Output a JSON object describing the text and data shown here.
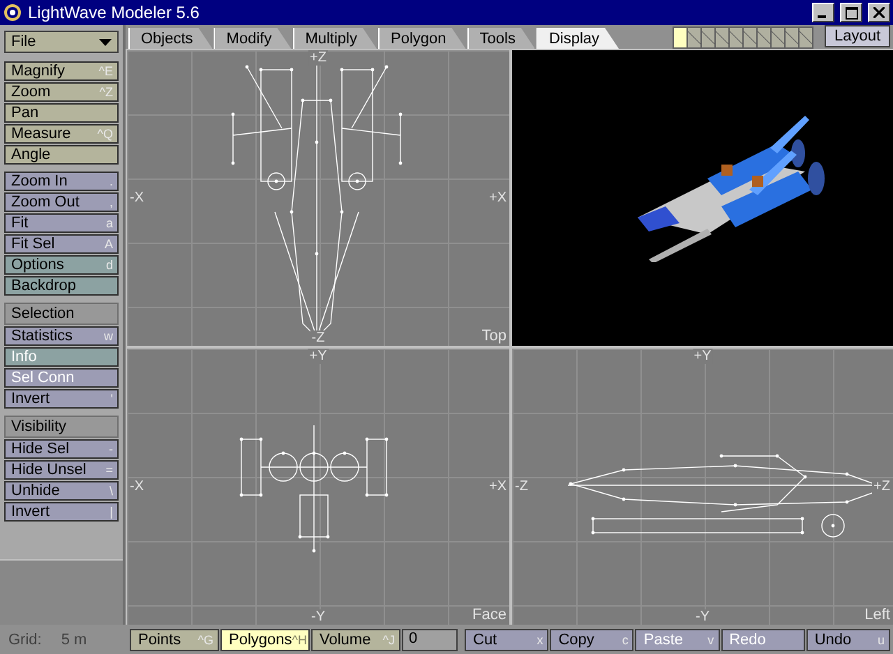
{
  "window": {
    "title": "LightWave Modeler 5.6"
  },
  "tabs": [
    {
      "label": "Objects",
      "selected": false
    },
    {
      "label": "Modify",
      "selected": false
    },
    {
      "label": "Multiply",
      "selected": false
    },
    {
      "label": "Polygon",
      "selected": false
    },
    {
      "label": "Tools",
      "selected": false
    },
    {
      "label": "Display",
      "selected": true
    }
  ],
  "layers": [
    {
      "selected": true
    },
    {
      "selected": false
    },
    {
      "selected": false
    },
    {
      "selected": false
    },
    {
      "selected": false
    },
    {
      "selected": false
    },
    {
      "selected": false
    },
    {
      "selected": false
    },
    {
      "selected": false
    },
    {
      "selected": false
    }
  ],
  "layout_button": "Layout",
  "sidebar": {
    "menu": "File",
    "groups": [
      {
        "kind": "tool",
        "items": [
          {
            "label": "Magnify",
            "shortcut": "^E",
            "disabled": false
          },
          {
            "label": "Zoom",
            "shortcut": "^Z",
            "disabled": false
          },
          {
            "label": "Pan",
            "disabled": false
          },
          {
            "label": "Measure",
            "shortcut": "^Q",
            "disabled": false
          },
          {
            "label": "Angle",
            "disabled": false
          }
        ]
      },
      {
        "kind": "view",
        "items": [
          {
            "label": "Zoom In",
            "shortcut": ".",
            "disabled": false
          },
          {
            "label": "Zoom Out",
            "shortcut": ",",
            "disabled": false
          },
          {
            "label": "Fit",
            "shortcut": "a",
            "disabled": false
          },
          {
            "label": "Fit Sel",
            "shortcut": "A",
            "disabled": false
          },
          {
            "label": "Options",
            "shortcut": "d",
            "kind": "option",
            "disabled": false
          },
          {
            "label": "Backdrop",
            "kind": "option",
            "disabled": false
          }
        ]
      },
      {
        "kind": "view",
        "header": "Selection",
        "items": [
          {
            "label": "Statistics",
            "shortcut": "w",
            "disabled": false
          },
          {
            "label": "Info",
            "kind": "option",
            "disabled": true
          },
          {
            "label": "Sel Conn",
            "disabled": true
          },
          {
            "label": "Invert",
            "shortcut": "'",
            "disabled": false
          }
        ]
      },
      {
        "kind": "view",
        "header": "Visibility",
        "items": [
          {
            "label": "Hide Sel",
            "shortcut": "-",
            "disabled": false
          },
          {
            "label": "Hide Unsel",
            "shortcut": "=",
            "disabled": false
          },
          {
            "label": "Unhide",
            "shortcut": "\\",
            "disabled": false
          },
          {
            "label": "Invert",
            "shortcut": "|",
            "disabled": false
          }
        ]
      }
    ]
  },
  "viewports": [
    {
      "kind": "top",
      "name": "Top",
      "top": "+Z",
      "bottom": "-Z",
      "left": "-X",
      "right": "+X"
    },
    {
      "kind": "perspective"
    },
    {
      "kind": "face",
      "name": "Face",
      "top": "+Y",
      "bottom": "-Y",
      "left": "-X",
      "right": "+X"
    },
    {
      "kind": "left",
      "name": "Left",
      "top": "+Y",
      "bottom": "-Y",
      "left": "-Z",
      "right": "+Z"
    }
  ],
  "status_bar": {
    "grid_label": "Grid:",
    "grid_value": "5 m",
    "modes": [
      {
        "label": "Points",
        "shortcut": "^G",
        "selected": false
      },
      {
        "label": "Polygons",
        "shortcut": "^H",
        "selected": true
      },
      {
        "label": "Volume",
        "shortcut": "^J",
        "selected": false
      }
    ],
    "count": "0",
    "actions": [
      {
        "label": "Cut",
        "shortcut": "x",
        "disabled": false
      },
      {
        "label": "Copy",
        "shortcut": "c",
        "disabled": false
      },
      {
        "label": "Paste",
        "shortcut": "v",
        "disabled": true
      },
      {
        "label": "Redo",
        "disabled": true
      },
      {
        "label": "Undo",
        "shortcut": "u",
        "disabled": false
      }
    ]
  }
}
